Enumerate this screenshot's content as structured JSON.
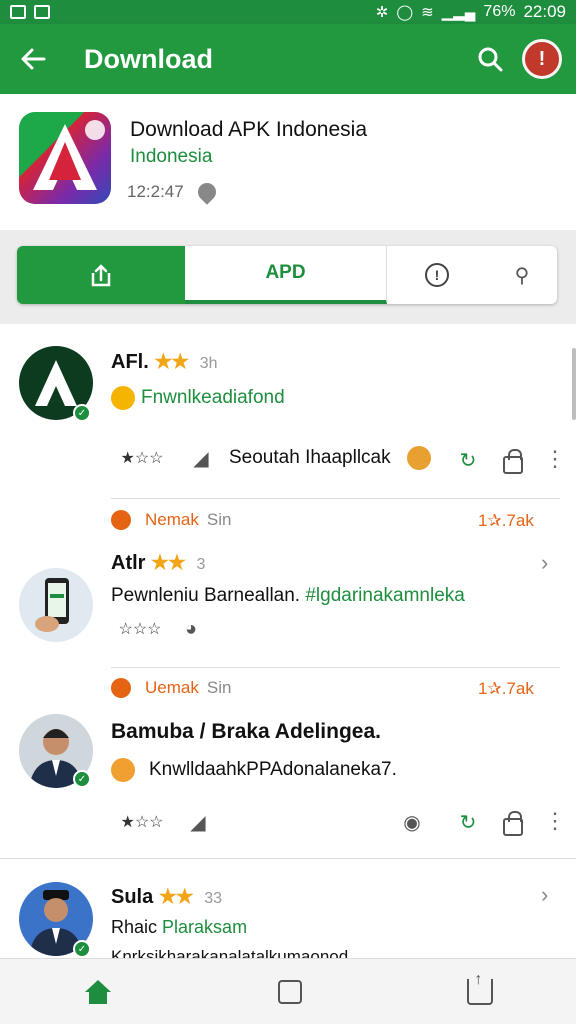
{
  "status_bar": {
    "battery": "76%",
    "time": "22:09"
  },
  "app_bar": {
    "title": "Download"
  },
  "app_card": {
    "name": "Download APK Indonesia",
    "region": "Indonesia",
    "meta": "12:2:47"
  },
  "tabs": {
    "active_label": "APD"
  },
  "posts": [
    {
      "name": "AFl.",
      "time": "3h",
      "subtitle": "Fnwnlkeadiafond",
      "footer": "Seoutah Ihaapllcak"
    },
    {
      "tag": "Nemak",
      "tag_time": "Sin",
      "rating": "1✰.7ak",
      "name": "Atlr",
      "time": "3",
      "text_plain": "Pewnleniu Barneallan. ",
      "text_green": "#lgdarinakamnleka",
      "footer": ""
    },
    {
      "tag": "Uemak",
      "tag_time": "Sin",
      "rating": "1✰.7ak",
      "name": "Bamuba / Braka Adelingea.",
      "text": "KnwlldaahkPPAdonalaneka7."
    },
    {
      "name": "Sula",
      "time": "33",
      "subtitle_plain": "Rhaic ",
      "subtitle_green": "Plaraksam",
      "text": "Knrksikharakanalatalkumaonod"
    }
  ],
  "colors": {
    "brand_green": "#22983f",
    "text_green": "#1e8e3e",
    "star": "#f2a516",
    "orange": "#e46414",
    "alert_red": "#c0392b"
  }
}
